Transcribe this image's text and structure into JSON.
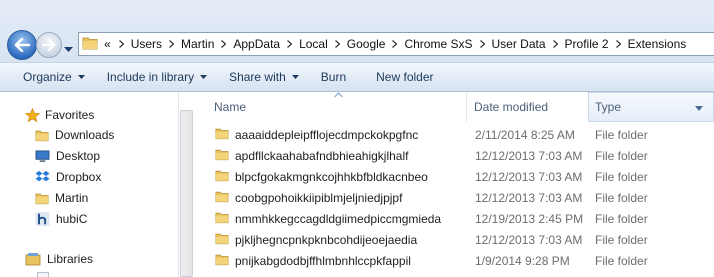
{
  "address": {
    "overflow": "«",
    "crumbs": [
      "Users",
      "Martin",
      "AppData",
      "Local",
      "Google",
      "Chrome SxS",
      "User Data",
      "Profile 2",
      "Extensions"
    ]
  },
  "toolbar": {
    "organize": "Organize",
    "include_in_library": "Include in library",
    "share_with": "Share with",
    "burn": "Burn",
    "new_folder": "New folder"
  },
  "nav": {
    "favorites_label": "Favorites",
    "items": [
      {
        "label": "Downloads",
        "icon": "folder-icon"
      },
      {
        "label": "Desktop",
        "icon": "desktop-icon"
      },
      {
        "label": "Dropbox",
        "icon": "dropbox-icon"
      },
      {
        "label": "Martin",
        "icon": "folder-icon"
      },
      {
        "label": "hubiC",
        "icon": "hubic-icon"
      }
    ],
    "libraries_label": "Libraries"
  },
  "columns": {
    "name": "Name",
    "date_modified": "Date modified",
    "type": "Type"
  },
  "files": [
    {
      "name": "aaaaiddepleipfflojecdmpckokpgfnc",
      "date": "2/11/2014 8:25 AM",
      "type": "File folder"
    },
    {
      "name": "apdfllckaahabafndbhieahigkjlhalf",
      "date": "12/12/2013 7:03 AM",
      "type": "File folder"
    },
    {
      "name": "blpcfgokakmgnkcojhhkbfbldkacnbeo",
      "date": "12/12/2013 7:03 AM",
      "type": "File folder"
    },
    {
      "name": "coobgpohoikkiipiblmjeljniedjpjpf",
      "date": "12/12/2013 7:03 AM",
      "type": "File folder"
    },
    {
      "name": "nmmhkkegccagdldgiimedpiccmgmieda",
      "date": "12/19/2013 2:45 PM",
      "type": "File folder"
    },
    {
      "name": "pjkljhegncpnkpknbcohdijeoejaedia",
      "date": "12/12/2013 7:03 AM",
      "type": "File folder"
    },
    {
      "name": "pnijkabgdodbjffhlmbnhlccpkfappil",
      "date": "1/9/2014 9:28 PM",
      "type": "File folder"
    }
  ],
  "colors": {
    "folder": "#e8c05a",
    "toolbar_text": "#1e395b",
    "star": "#f2b01e"
  }
}
